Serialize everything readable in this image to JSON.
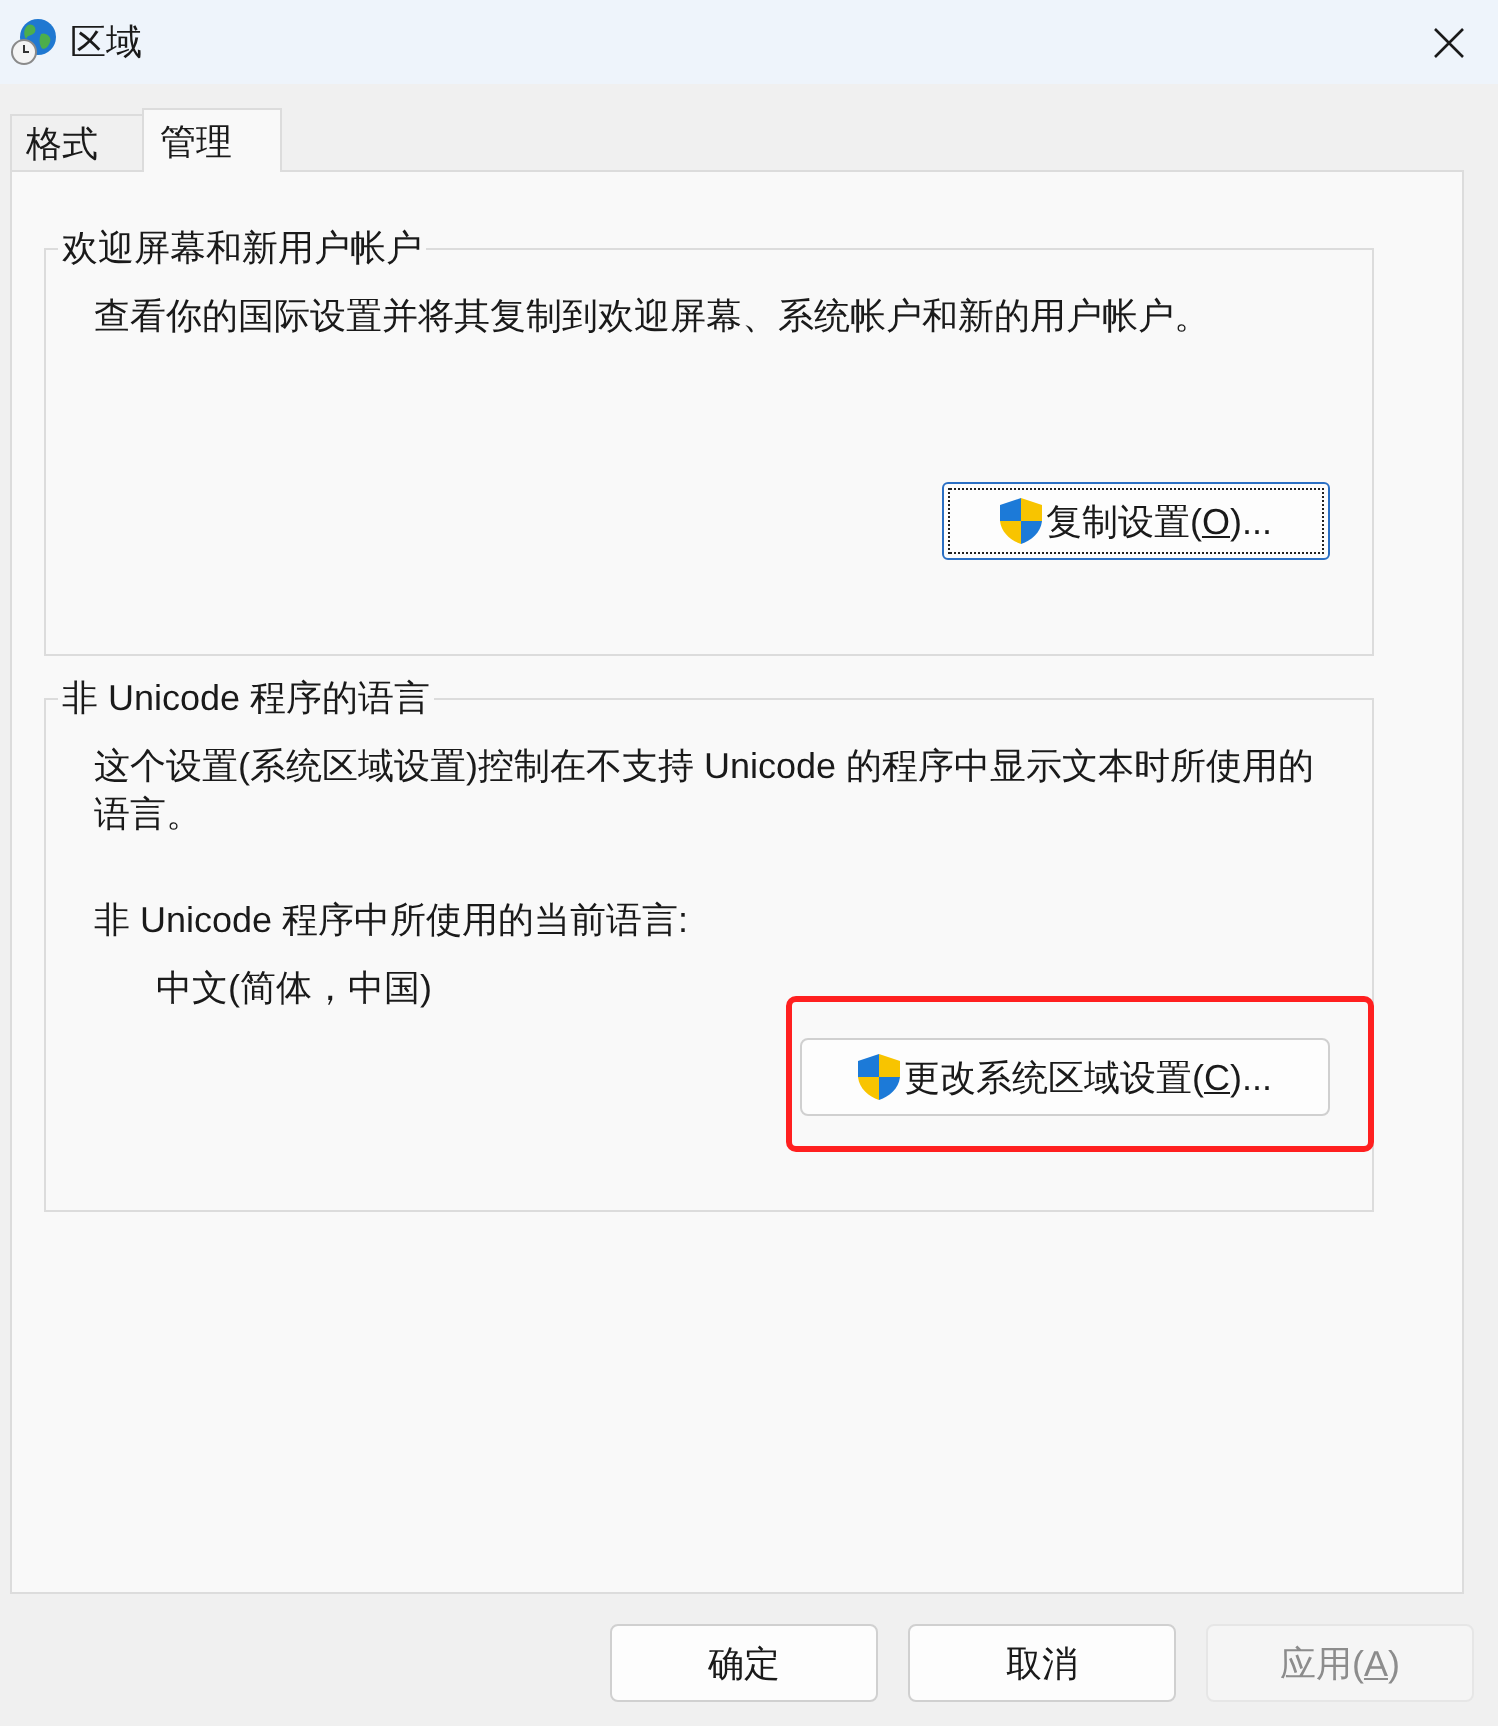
{
  "window": {
    "title": "区域"
  },
  "tabs": [
    {
      "label": "格式",
      "selected": false
    },
    {
      "label": "管理",
      "selected": true
    }
  ],
  "groups": [
    {
      "title": "欢迎屏幕和新用户帐户",
      "description": "查看你的国际设置并将其复制到欢迎屏幕、系统帐户和新的用户帐户。",
      "button": {
        "label": "复制设置(",
        "access_key": "O",
        "label_rest": ")...",
        "shield": true,
        "focused": true,
        "highlighted": false
      }
    },
    {
      "title": "非 Unicode 程序的语言",
      "description": "这个设置(系统区域设置)控制在不支持 Unicode 的程序中显示文本时所使用的语言。",
      "current_language_label": "非 Unicode 程序中所使用的当前语言:",
      "current_language": "中文(简体，中国)",
      "button": {
        "label": "更改系统区域设置(",
        "access_key": "C",
        "label_rest": ")...",
        "shield": true,
        "focused": false,
        "highlighted": true
      }
    }
  ],
  "buttons": [
    {
      "label": "确定",
      "disabled": false
    },
    {
      "label": "取消",
      "disabled": false
    },
    {
      "label": "应用(",
      "access_key": "A",
      "label_rest": ")",
      "disabled": true
    }
  ]
}
